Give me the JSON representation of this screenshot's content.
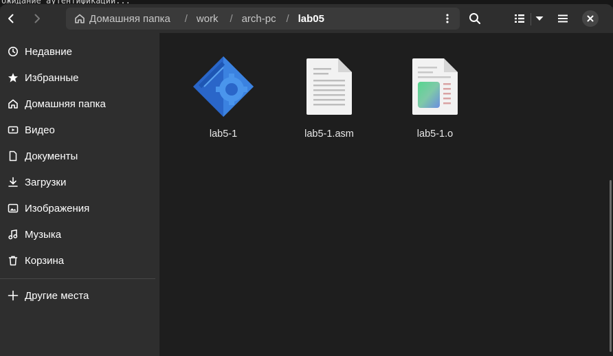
{
  "terminal": {
    "text": "ожидание аутентификации..."
  },
  "header": {
    "back_icon": "chevron-left-icon",
    "forward_icon": "chevron-right-icon",
    "breadcrumbs": [
      {
        "label": "Домашняя папка",
        "icon": "home-icon"
      },
      {
        "label": "work"
      },
      {
        "label": "arch-pc"
      },
      {
        "label": "lab05"
      }
    ],
    "menu_icon": "vertical-dots-icon",
    "search_icon": "search-icon",
    "view_icon": "list-view-icon",
    "view_dropdown_icon": "chevron-down-icon",
    "main_menu_icon": "hamburger-menu-icon",
    "close_icon": "close-icon"
  },
  "sidebar": {
    "items": [
      {
        "label": "Недавние",
        "icon": "clock-icon"
      },
      {
        "label": "Избранные",
        "icon": "star-icon"
      },
      {
        "label": "Домашняя папка",
        "icon": "home-icon"
      },
      {
        "label": "Видео",
        "icon": "video-icon"
      },
      {
        "label": "Документы",
        "icon": "document-icon"
      },
      {
        "label": "Загрузки",
        "icon": "download-icon"
      },
      {
        "label": "Изображения",
        "icon": "image-icon"
      },
      {
        "label": "Музыка",
        "icon": "music-icon"
      },
      {
        "label": "Корзина",
        "icon": "trash-icon"
      }
    ],
    "other": {
      "label": "Другие места",
      "icon": "plus-icon"
    }
  },
  "files": [
    {
      "name": "lab5-1",
      "icon": "executable-icon"
    },
    {
      "name": "lab5-1.asm",
      "icon": "text-file-icon"
    },
    {
      "name": "lab5-1.o",
      "icon": "object-file-icon"
    }
  ],
  "colors": {
    "headerbar": "#2e2e2e",
    "sidebar": "#2e2e2e",
    "content": "#1e1e1e",
    "pathbar": "#3a3a3a",
    "accent_blue": "#2d6fd3"
  }
}
